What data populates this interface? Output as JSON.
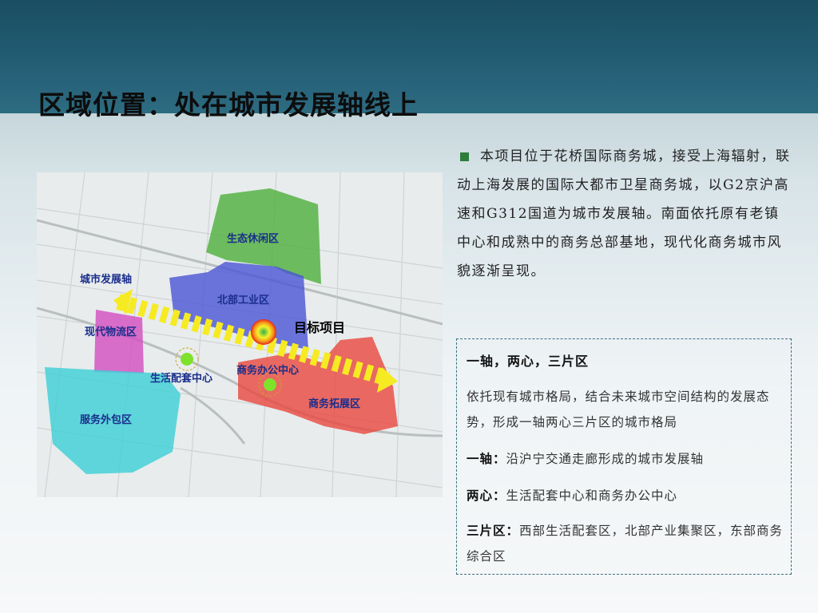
{
  "slide": {
    "title": "区域位置：处在城市发展轴线上"
  },
  "intro": {
    "text": "本项目位于花桥国际商务城，接受上海辐射，联动上海发展的国际大都市卫星商务城，以G2京沪高速和G312国道为城市发展轴。南面依托原有老镇中心和成熟中的商务总部基地，现代化商务城市风貌逐渐呈现。"
  },
  "panel": {
    "title": "一轴，两心，三片区",
    "body": "依托现有城市格局，结合未来城市空间结构的发展态势，形成一轴两心三片区的城市格局",
    "axis_label": "一轴：",
    "axis_text": "沿沪宁交通走廊形成的城市发展轴",
    "centers_label": "两心：",
    "centers_text": "生活配套中心和商务办公中心",
    "zones_label": "三片区：",
    "zones_text": "西部生活配套区，北部产业集聚区，东部商务综合区"
  },
  "map": {
    "labels": {
      "eco": "生态休闲区",
      "axis": "城市发展轴",
      "north": "北部工业区",
      "logistics": "现代物流区",
      "target": "目标项目",
      "life": "生活配套中心",
      "office": "商务办公中心",
      "expansion": "商务拓展区",
      "outsourcing": "服务外包区"
    }
  }
}
